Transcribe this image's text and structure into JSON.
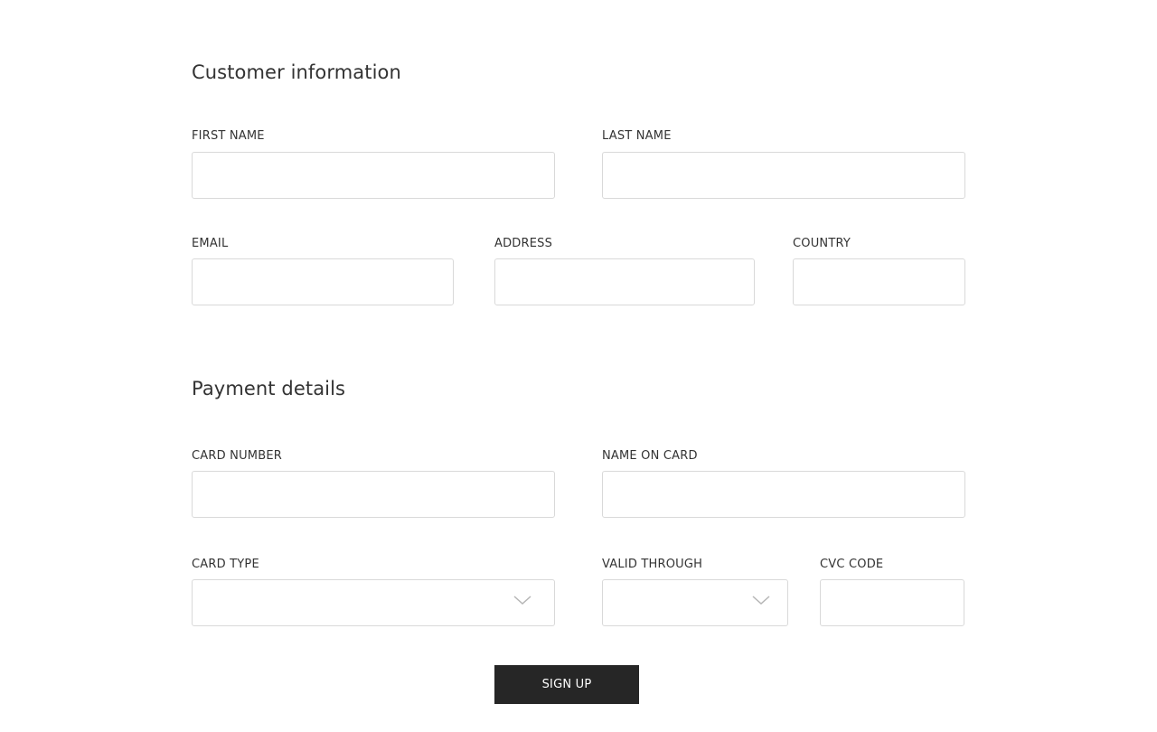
{
  "customer_section": {
    "title": "Customer information",
    "first_name": {
      "label": "FIRST NAME",
      "value": ""
    },
    "last_name": {
      "label": "LAST NAME",
      "value": ""
    },
    "email": {
      "label": "EMAIL",
      "value": ""
    },
    "address": {
      "label": "ADDRESS",
      "value": ""
    },
    "country": {
      "label": "COUNTRY",
      "value": ""
    }
  },
  "payment_section": {
    "title": "Payment details",
    "card_number": {
      "label": "CARD NUMBER",
      "value": ""
    },
    "name_on_card": {
      "label": "NAME ON CARD",
      "value": ""
    },
    "card_type": {
      "label": "CARD TYPE",
      "value": "",
      "icon": "chevron-down-icon"
    },
    "valid_through": {
      "label": "VALID THROUGH",
      "value": "",
      "icon": "chevron-down-icon"
    },
    "cvc_code": {
      "label": "CVC CODE",
      "value": ""
    }
  },
  "submit": {
    "label": "SIGN UP"
  },
  "colors": {
    "button_background": "#262626",
    "button_text": "#ffffff",
    "field_border": "#d9d9d9",
    "text": "#333333"
  }
}
